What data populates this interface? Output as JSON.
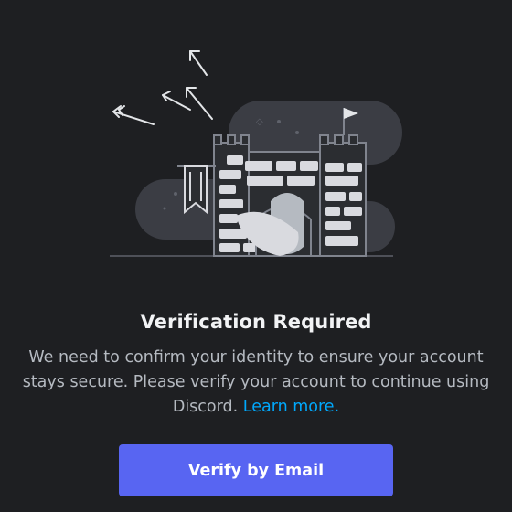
{
  "dialog": {
    "illustration_icon": "castle-with-shield-and-arrows-icon",
    "title": "Verification Required",
    "message_text": "We need to confirm your identity to ensure your account stays secure. Please verify your account to continue using Discord.",
    "learn_more_label": "Learn more.",
    "verify_button_label": "Verify by Email"
  },
  "colors": {
    "background": "#1e1f22",
    "title": "#f2f3f5",
    "body_text": "#b5bac1",
    "link": "#00a8fc",
    "button": "#5865f2",
    "button_text": "#ffffff"
  }
}
